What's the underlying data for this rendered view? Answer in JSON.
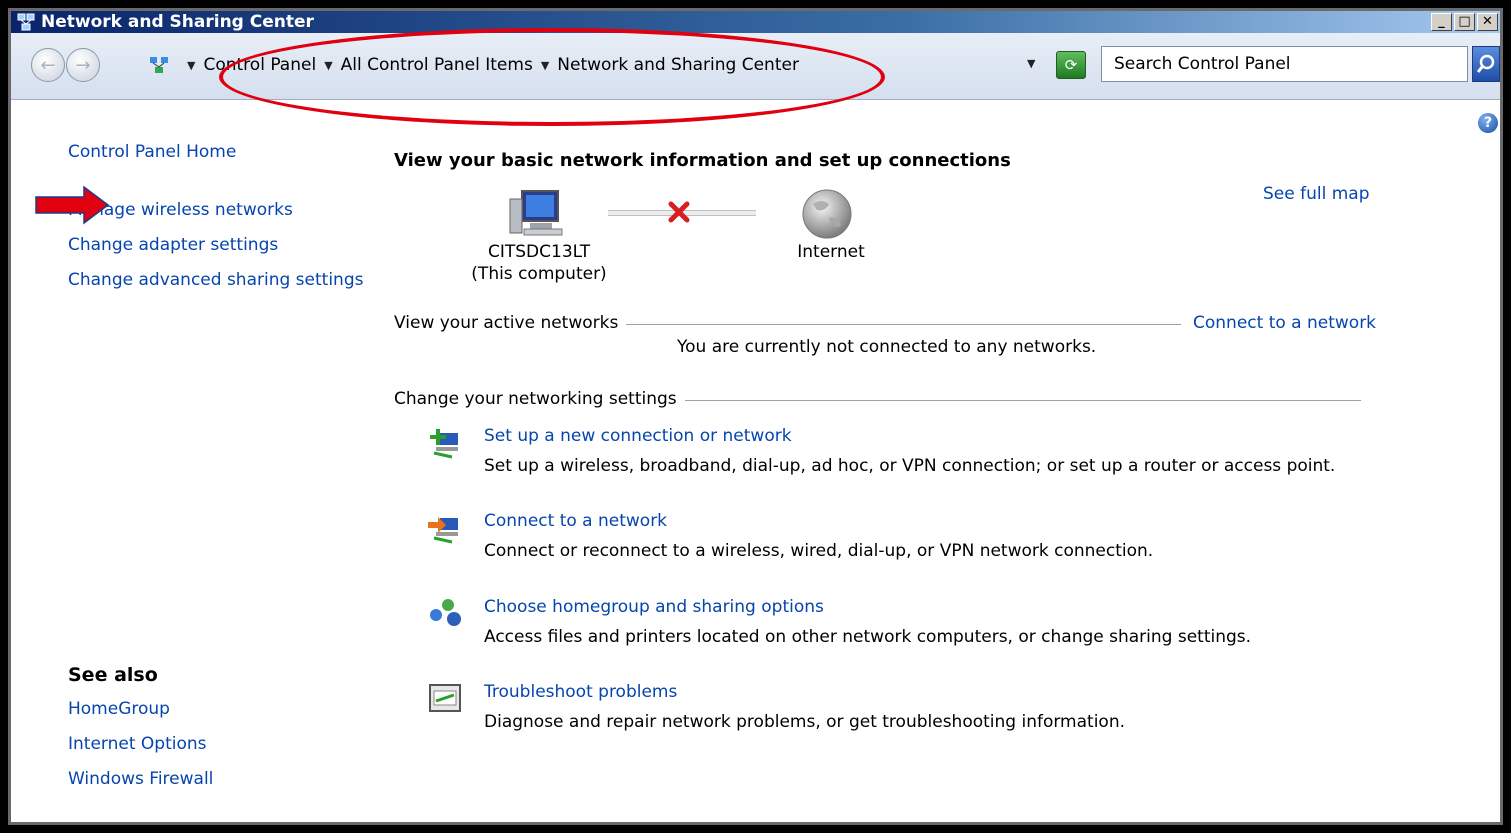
{
  "window": {
    "title": "Network and Sharing Center",
    "minimize_label": "_",
    "maximize_label": "□",
    "close_label": "✕"
  },
  "address": {
    "crumbs": [
      "Control Panel",
      "All Control Panel Items",
      "Network and Sharing Center"
    ],
    "search_placeholder": "Search Control Panel"
  },
  "sidebar": {
    "home": "Control Panel Home",
    "links": [
      "Manage wireless networks",
      "Change adapter settings",
      "Change advanced sharing settings"
    ],
    "see_also_title": "See also",
    "see_also": [
      "HomeGroup",
      "Internet Options",
      "Windows Firewall"
    ]
  },
  "main": {
    "title": "View your basic network information and set up connections",
    "see_full_map": "See full map",
    "computer_name": "CITSDC13LT",
    "computer_sub": "(This computer)",
    "internet_label": "Internet",
    "active_networks_label": "View your active networks",
    "connect_link": "Connect to a network",
    "not_connected": "You are currently not connected to any networks.",
    "change_settings_label": "Change your networking settings",
    "tasks": [
      {
        "title": "Set up a new connection or network",
        "desc": "Set up a wireless, broadband, dial-up, ad hoc, or VPN connection; or set up a router or access point.",
        "icon": "new-connection-icon"
      },
      {
        "title": "Connect to a network",
        "desc": "Connect or reconnect to a wireless, wired, dial-up, or VPN network connection.",
        "icon": "connect-network-icon"
      },
      {
        "title": "Choose homegroup and sharing options",
        "desc": "Access files and printers located on other network computers, or change sharing settings.",
        "icon": "homegroup-icon"
      },
      {
        "title": "Troubleshoot problems",
        "desc": "Diagnose and repair network problems, or get troubleshooting information.",
        "icon": "troubleshoot-icon"
      }
    ]
  },
  "annotations": {
    "highlight_color": "#e0000f"
  }
}
